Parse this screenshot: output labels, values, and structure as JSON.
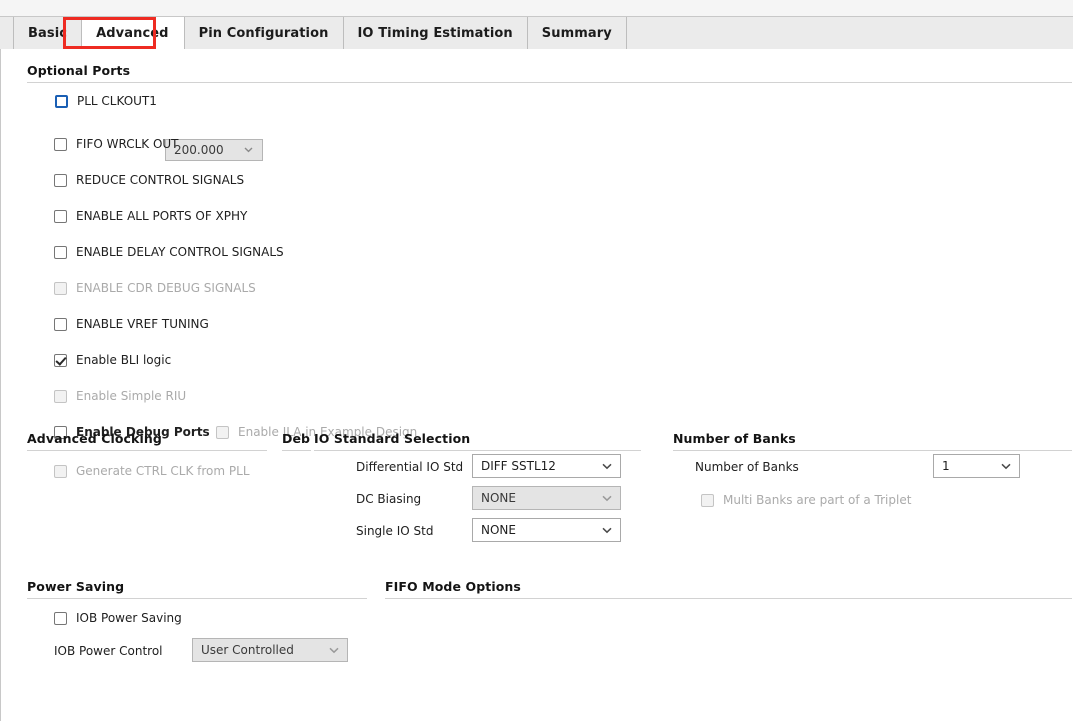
{
  "tabs": [
    {
      "label": "Basic",
      "active": false
    },
    {
      "label": "Advanced",
      "active": true
    },
    {
      "label": "Pin Configuration",
      "active": false
    },
    {
      "label": "IO Timing Estimation",
      "active": false
    },
    {
      "label": "Summary",
      "active": false
    }
  ],
  "highlight_color": "#ee2b22",
  "sections": {
    "optional_ports": {
      "title": "Optional Ports"
    },
    "advanced_clocking": {
      "title": "Advanced Clocking"
    },
    "debug": {
      "title": "Debug"
    },
    "io_standard_selection": {
      "title": "IO Standard Selection"
    },
    "number_of_banks": {
      "title": "Number of Banks"
    },
    "power_saving": {
      "title": "Power Saving"
    },
    "fifo_mode_options": {
      "title": "FIFO Mode Options"
    }
  },
  "optional_ports": {
    "pll_clkout1": {
      "label": "PLL CLKOUT1",
      "checked": false,
      "focused": true,
      "value": "200.000",
      "value_disabled": true
    },
    "checkboxes": [
      {
        "label": "FIFO WRCLK OUT",
        "checked": false,
        "disabled": false,
        "bold": false
      },
      {
        "label": "REDUCE CONTROL SIGNALS",
        "checked": false,
        "disabled": false,
        "bold": false
      },
      {
        "label": "ENABLE ALL PORTS OF XPHY",
        "checked": false,
        "disabled": false,
        "bold": false
      },
      {
        "label": "ENABLE DELAY CONTROL SIGNALS",
        "checked": false,
        "disabled": false,
        "bold": false
      },
      {
        "label": "ENABLE CDR DEBUG SIGNALS",
        "checked": false,
        "disabled": true,
        "bold": false
      },
      {
        "label": "ENABLE VREF TUNING",
        "checked": false,
        "disabled": false,
        "bold": false
      },
      {
        "label": "Enable BLI logic",
        "checked": true,
        "disabled": false,
        "bold": false
      },
      {
        "label": "Enable Simple RIU",
        "checked": false,
        "disabled": true,
        "bold": false
      },
      {
        "label": "Enable Debug Ports",
        "checked": false,
        "disabled": false,
        "bold": true
      }
    ],
    "enable_ila": {
      "label": "Enable ILA in Example Design",
      "checked": false,
      "disabled": true
    }
  },
  "advanced_clocking": {
    "generate_ctrl_clk": {
      "label": "Generate CTRL CLK from PLL",
      "checked": false,
      "disabled": true
    }
  },
  "io_standard_selection": {
    "rows": [
      {
        "label": "Differential IO Std",
        "value": "DIFF SSTL12",
        "disabled": false
      },
      {
        "label": "DC Biasing",
        "value": "NONE",
        "disabled": true
      },
      {
        "label": "Single IO Std",
        "value": "NONE",
        "disabled": false
      }
    ]
  },
  "number_of_banks": {
    "label": "Number of Banks",
    "value": "1",
    "disabled": false,
    "multi_banks": {
      "label": "Multi Banks are part of a Triplet",
      "checked": false,
      "disabled": true
    }
  },
  "power_saving": {
    "iob_power_saving": {
      "label": "IOB Power Saving",
      "checked": false,
      "disabled": false
    },
    "iob_power_control": {
      "label": "IOB Power Control",
      "value": "User Controlled",
      "disabled": true
    }
  }
}
